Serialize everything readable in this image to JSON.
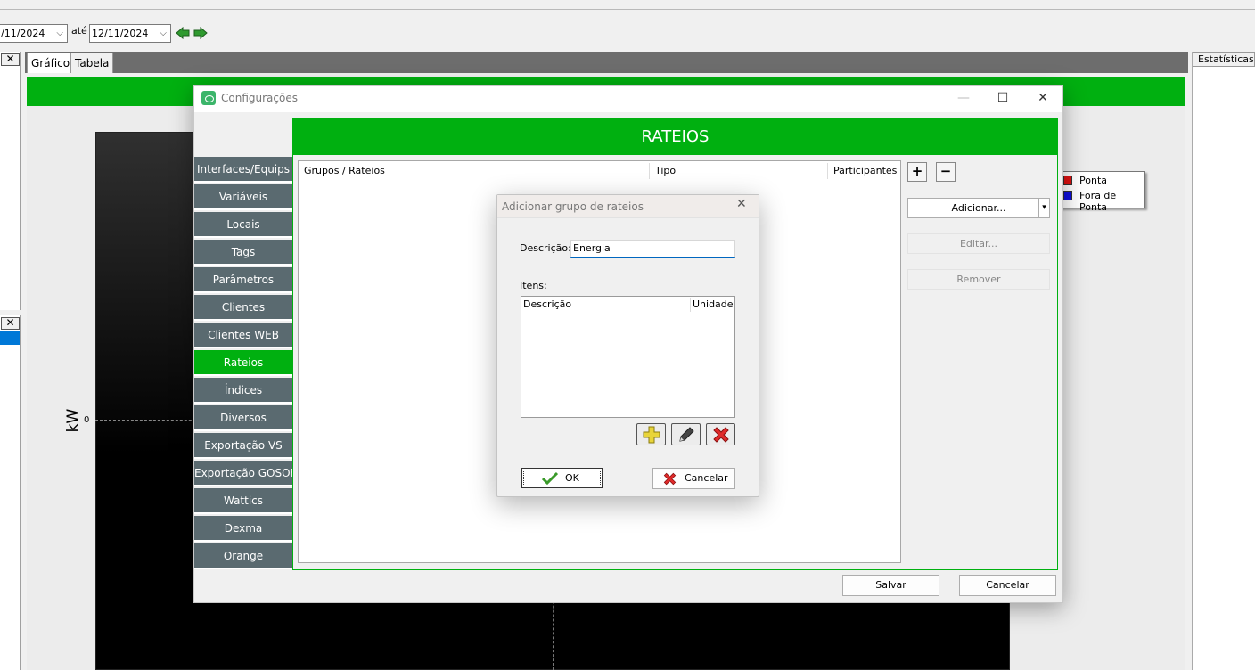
{
  "toolbar": {
    "date_from": "/11/2024",
    "ate_label": "até",
    "date_to": "12/11/2024",
    "dropdown_glyph": "⌵"
  },
  "panels": {
    "close_glyph": "✕",
    "tabs": [
      "Gráfico",
      "Tabela"
    ],
    "stats_tab": "Estatísticas"
  },
  "chart_data": {
    "type": "line",
    "title": "",
    "ylabel": "kW",
    "yticks": [
      "0"
    ],
    "legend": [
      {
        "name": "Ponta",
        "color": "#e01010"
      },
      {
        "name": "Fora de Ponta",
        "color": "#1010e0"
      }
    ],
    "series": []
  },
  "window": {
    "title": "Configurações",
    "minimize": "—",
    "maximize": "☐",
    "close": "✕",
    "nav": [
      "Interfaces/Equips",
      "Variáveis",
      "Locais",
      "Tags",
      "Parâmetros",
      "Clientes",
      "Clientes WEB",
      "Rateios",
      "Índices",
      "Diversos",
      "Exportação VS",
      "Exportação GOSOFT",
      "Wattics",
      "Dexma",
      "Orange"
    ],
    "active_nav": "Rateios",
    "header": "RATEIOS",
    "columns": [
      "Grupos / Rateios",
      "Tipo",
      "Participantes"
    ],
    "expand_glyph": "+",
    "collapse_glyph": "−",
    "add_button": "Adicionar...",
    "add_split_glyph": "▾",
    "edit_button": "Editar...",
    "remove_button": "Remover",
    "save_button": "Salvar",
    "cancel_button": "Cancelar"
  },
  "dialog": {
    "title": "Adicionar grupo de rateios",
    "close": "✕",
    "descricao_label": "Descrição:",
    "descricao_value": "Energia",
    "itens_label": "Itens:",
    "columns": [
      "Descrição",
      "Unidade"
    ],
    "ok_button": "OK",
    "cancel_button": "Cancelar"
  },
  "colors": {
    "accent_green": "#00b010",
    "nav_gray": "#5a6a70",
    "focus_blue": "#0067c0"
  }
}
